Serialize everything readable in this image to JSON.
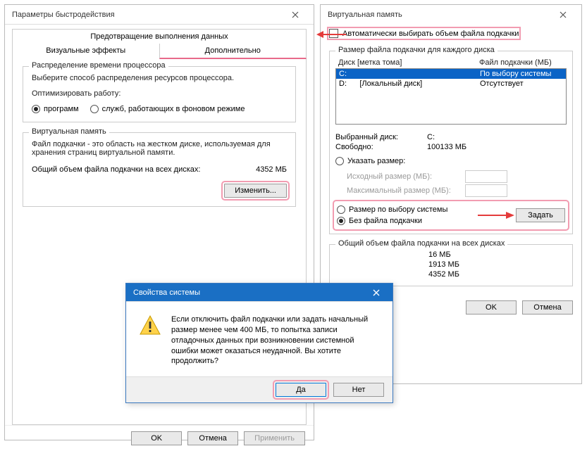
{
  "perf": {
    "title": "Параметры быстродействия",
    "tabs": {
      "dep": "Предотвращение выполнения данных",
      "visual": "Визуальные эффекты",
      "advanced": "Дополнительно"
    },
    "cpu": {
      "group": "Распределение времени процессора",
      "desc": "Выберите способ распределения ресурсов процессора.",
      "optimize": "Оптимизировать работу:",
      "programs": "программ",
      "services": "служб, работающих в фоновом режиме"
    },
    "vm": {
      "group": "Виртуальная память",
      "desc": "Файл подкачки - это область на жестком диске, используемая для хранения страниц виртуальной памяти.",
      "total_label": "Общий объем файла подкачки на всех дисках:",
      "total_value": "4352 МБ",
      "change": "Изменить..."
    },
    "buttons": {
      "ok": "OK",
      "cancel": "Отмена",
      "apply": "Применить"
    }
  },
  "vmdlg": {
    "title": "Виртуальная память",
    "auto": "Автоматически выбирать объем файла подкачки",
    "group_each": "Размер файла подкачки для каждого диска",
    "col_disk": "Диск [метка тома]",
    "col_file": "Файл подкачки (МБ)",
    "rows": [
      {
        "disk": "C:",
        "label": "",
        "file": "По выбору системы"
      },
      {
        "disk": "D:",
        "label": "[Локальный диск]",
        "file": "Отсутствует"
      }
    ],
    "selected": {
      "label": "Выбранный диск:",
      "value": "C:"
    },
    "free": {
      "label": "Свободно:",
      "value": "100133 МБ"
    },
    "custom": "Указать размер:",
    "initial": "Исходный размер (МБ):",
    "max": "Максимальный размер (МБ):",
    "system": "Размер по выбору системы",
    "none": "Без файла подкачки",
    "set": "Задать",
    "totals_group": "Общий объем файла подкачки на всех дисках",
    "min": {
      "v": "16 МБ"
    },
    "rec": {
      "v": "1913 МБ"
    },
    "cur": {
      "v": "4352 МБ"
    },
    "ok": "OK",
    "cancel": "Отмена"
  },
  "msg": {
    "title": "Свойства системы",
    "text": "Если отключить файл подкачки или задать начальный размер менее чем 400 МБ, то попытка записи отладочных данных при возникновении системной ошибки может оказаться неудачной. Вы хотите продолжить?",
    "yes": "Да",
    "no": "Нет"
  }
}
